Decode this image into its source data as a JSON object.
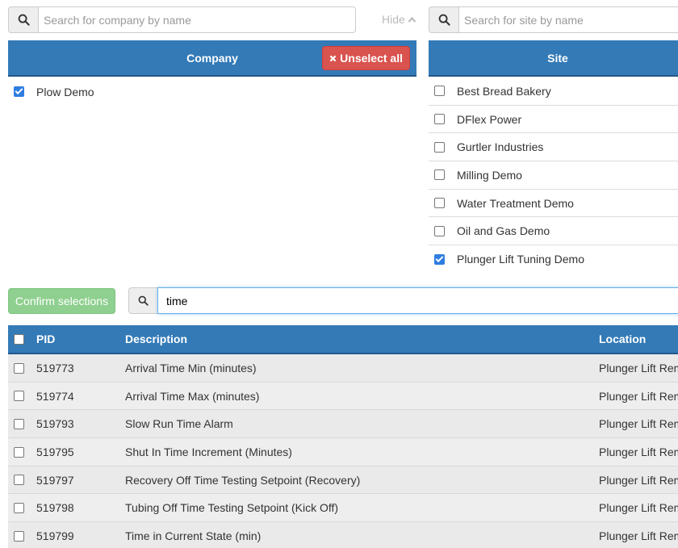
{
  "company_search": {
    "placeholder": "Search for company by name"
  },
  "site_search": {
    "placeholder": "Search for site by name"
  },
  "hide_link": {
    "label": "Hide"
  },
  "company_panel": {
    "header": "Company",
    "unselect_label": "Unselect all",
    "items": [
      {
        "label": "Plow Demo",
        "checked": true
      }
    ]
  },
  "site_panel": {
    "header": "Site",
    "items": [
      {
        "label": "Best Bread Bakery",
        "checked": false
      },
      {
        "label": "DFlex Power",
        "checked": false
      },
      {
        "label": "Gurtler Industries",
        "checked": false
      },
      {
        "label": "Milling Demo",
        "checked": false
      },
      {
        "label": "Water Treatment Demo",
        "checked": false
      },
      {
        "label": "Oil and Gas Demo",
        "checked": false
      },
      {
        "label": "Plunger Lift Tuning Demo",
        "checked": true
      }
    ]
  },
  "confirm_button": {
    "label": "Confirm selections"
  },
  "param_search": {
    "value": "time"
  },
  "table": {
    "columns": {
      "pid": "PID",
      "description": "Description",
      "location": "Location"
    },
    "rows": [
      {
        "pid": "519773",
        "description": "Arrival Time Min (minutes)",
        "location": "Plunger Lift Rem"
      },
      {
        "pid": "519774",
        "description": "Arrival Time Max (minutes)",
        "location": "Plunger Lift Rem"
      },
      {
        "pid": "519793",
        "description": "Slow Run Time Alarm",
        "location": "Plunger Lift Rem"
      },
      {
        "pid": "519795",
        "description": "Shut In Time Increment (Minutes)",
        "location": "Plunger Lift Rem"
      },
      {
        "pid": "519797",
        "description": "Recovery Off Time Testing Setpoint (Recovery)",
        "location": "Plunger Lift Rem"
      },
      {
        "pid": "519798",
        "description": "Tubing Off Time Testing Setpoint (Kick Off)",
        "location": "Plunger Lift Rem"
      },
      {
        "pid": "519799",
        "description": "Time in Current State (min)",
        "location": "Plunger Lift Rem"
      }
    ]
  },
  "colors": {
    "header_blue": "#337ab7",
    "danger_red": "#d9534f",
    "success_green_disabled": "#8fcf8f",
    "checkbox_blue": "#2f7de1"
  }
}
